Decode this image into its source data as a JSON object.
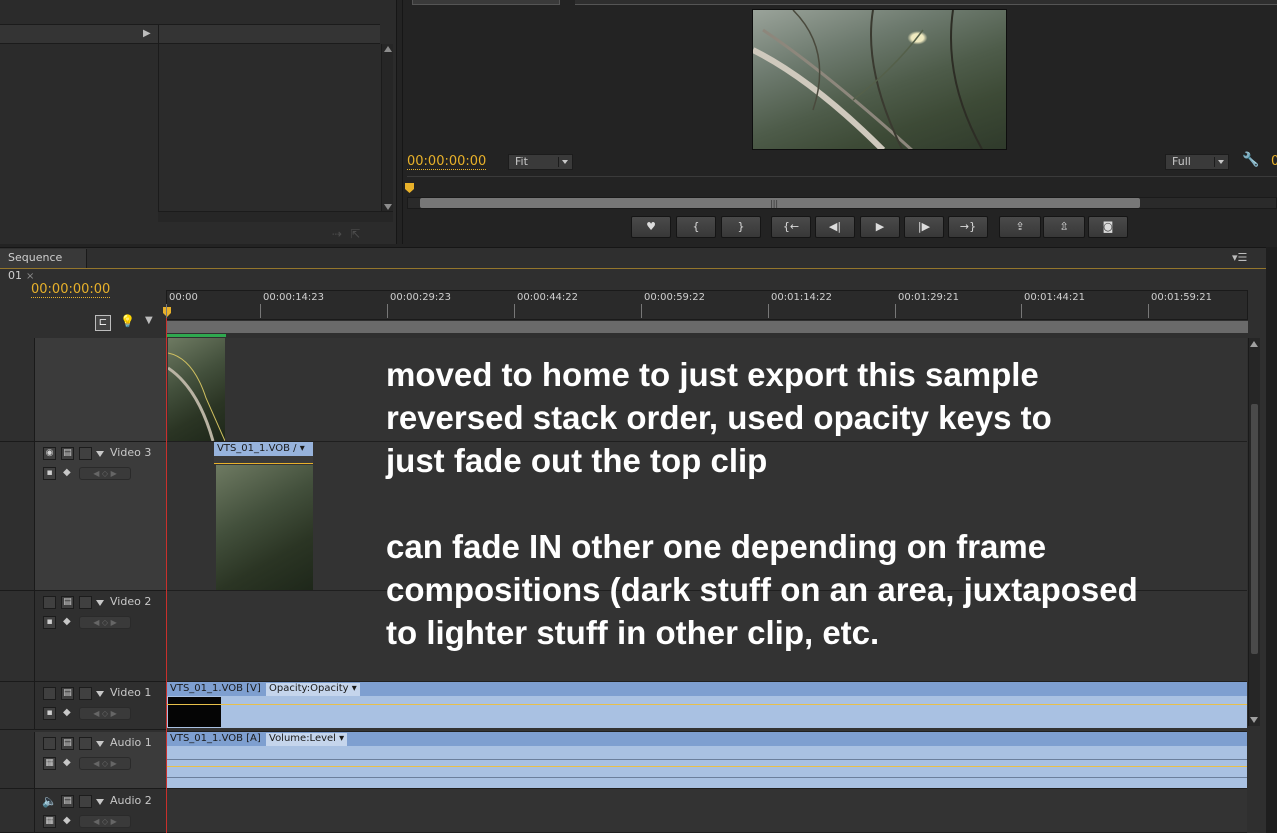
{
  "program": {
    "timecode": "00:00:00:00",
    "fit_value": "Fit",
    "quality_value": "Full",
    "cut_text": "0"
  },
  "transport": {
    "buttons": [
      {
        "name": "add-marker-button",
        "icon": "marker-icon",
        "glyph": "♥"
      },
      {
        "name": "mark-in-button",
        "icon": "mark-in-icon",
        "glyph": "{"
      },
      {
        "name": "mark-out-button",
        "icon": "mark-out-icon",
        "glyph": "}"
      },
      {
        "name": "go-to-in-button",
        "icon": "go-to-in-icon",
        "glyph": "{←"
      },
      {
        "name": "step-back-button",
        "icon": "step-back-icon",
        "glyph": "◀|"
      },
      {
        "name": "play-button",
        "icon": "play-icon",
        "glyph": "▶"
      },
      {
        "name": "step-forward-button",
        "icon": "step-forward-icon",
        "glyph": "|▶"
      },
      {
        "name": "go-to-out-button",
        "icon": "go-to-out-icon",
        "glyph": "→}"
      },
      {
        "name": "lift-button",
        "icon": "lift-icon",
        "glyph": "⇪"
      },
      {
        "name": "extract-button",
        "icon": "extract-icon",
        "glyph": "⇫"
      },
      {
        "name": "export-frame-button",
        "icon": "camera-icon",
        "glyph": "◙"
      }
    ]
  },
  "timeline": {
    "tab_label": "Sequence 01",
    "tab_close": "×",
    "timecode": "00:00:00:00",
    "ruler_ticks": [
      "00:00",
      "00:00:14:23",
      "00:00:29:23",
      "00:00:44:22",
      "00:00:59:22",
      "00:01:14:22",
      "00:01:29:21",
      "00:01:44:21",
      "00:01:59:21"
    ],
    "tracks": {
      "video3": "Video 3",
      "video2": "Video 2",
      "video1": "Video 1",
      "audio1": "Audio 1",
      "audio2": "Audio 2"
    },
    "clips": {
      "video3_clip": "VTS_01_1.VOB",
      "video1_clip": "VTS_01_1.VOB [V]",
      "video1_fx": "Opacity:Opacity",
      "audio1_clip": "VTS_01_1.VOB [A]",
      "audio1_fx": "Volume:Level"
    }
  },
  "annotation": {
    "text": "moved to home to just export this sample\nreversed stack order, used opacity keys to\njust fade out the top clip\n\ncan fade IN other one depending on frame\ncompositions (dark stuff on an area, juxtaposed\nto lighter stuff in other clip, etc."
  },
  "colors": {
    "accent_timecode": "#e8b12a",
    "clip_video": "#97b3dc",
    "playhead": "#c9302c"
  }
}
